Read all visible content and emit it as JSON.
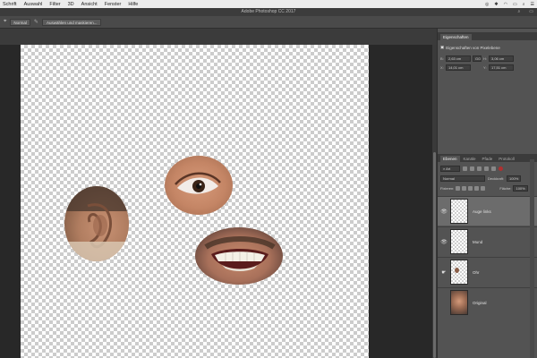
{
  "menubar": {
    "items": [
      "Schrift",
      "Auswahl",
      "Filter",
      "3D",
      "Ansicht",
      "Fenster",
      "Hilfe"
    ]
  },
  "titlebar": {
    "title": "Adobe Photoshop CC 2017"
  },
  "options": {
    "mode": "Normal",
    "select_subject_label": "Auswählen und maskieren..."
  },
  "properties": {
    "tab": "Eigenschaften",
    "header": "Eigenschaften von Pixelebene",
    "fields": {
      "w_label": "B:",
      "w_value": "2,63 cm",
      "link_label": "GO",
      "h_label": "H:",
      "h_value": "3,06 cm",
      "x_label": "X:",
      "x_value": "14,01 cm",
      "y_label": "Y:",
      "y_value": "17,51 cm"
    }
  },
  "layers_panel": {
    "tabs": [
      "Ebenen",
      "Kanäle",
      "Pfade",
      "Protokoll"
    ],
    "filter_kind": "Art",
    "blend_mode": "Normal",
    "opacity_label": "Deckkraft:",
    "opacity_value": "100%",
    "lock_label": "Fixieren:",
    "fill_label": "Fläche:",
    "fill_value": "100%",
    "layers": [
      {
        "name": "Auge links",
        "visible": true,
        "selected": true
      },
      {
        "name": "Mund",
        "visible": true,
        "selected": false
      },
      {
        "name": "Ohr",
        "visible": false,
        "selected": false
      },
      {
        "name": "Original",
        "visible": false,
        "selected": false
      }
    ]
  },
  "colors": {
    "panel_bg": "#535353",
    "workspace_bg": "#282828",
    "selected_layer": "#6c6c6c"
  }
}
